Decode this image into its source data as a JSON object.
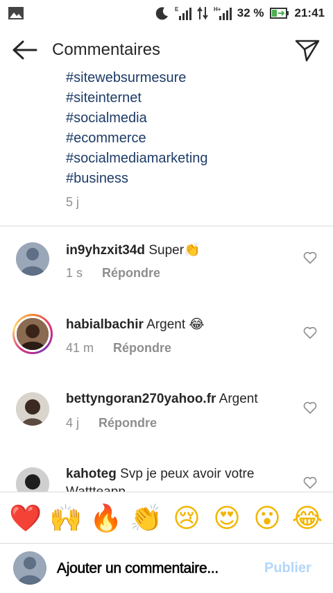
{
  "status_bar": {
    "battery": "32 %",
    "time": "21:41",
    "icons": [
      "image-icon",
      "moon-icon",
      "signal-e-icon",
      "data-arrows-icon",
      "signal-h-icon",
      "battery-icon"
    ]
  },
  "header": {
    "title": "Commentaires",
    "back_icon": "arrow-left-icon",
    "send_icon": "send-icon"
  },
  "caption": {
    "hashtags": [
      "#sitewebsurmesure",
      "#siteinternet",
      "#socialmedia",
      "#ecommerce",
      "#socialmediamarketing",
      "#business"
    ],
    "time": "5 j"
  },
  "comments": [
    {
      "username": "in9yhzxit34d",
      "text": "Super👏",
      "time": "1 s",
      "reply_label": "Répondre",
      "story_ring": false
    },
    {
      "username": "habialbachir",
      "text": "Argent 😂",
      "time": "41 m",
      "reply_label": "Répondre",
      "story_ring": true
    },
    {
      "username": "bettyngoran270yahoo.fr",
      "text": "Argent",
      "time": "4 j",
      "reply_label": "Répondre",
      "story_ring": false
    },
    {
      "username": "kahoteg",
      "text": "Svp je peux avoir votre",
      "text_cont": "Wattteapp",
      "story_ring": false
    }
  ],
  "reactions": [
    "❤️",
    "🙌",
    "🔥",
    "👏",
    "😢",
    "😍",
    "😮",
    "😂"
  ],
  "composer": {
    "placeholder": "Ajouter un commentaire...",
    "publish_label": "Publier"
  },
  "colors": {
    "hashtag": "#1d3b67",
    "meta_gray": "#8e8e8e",
    "publish_disabled": "#b3d6fa",
    "divider": "#dbdbdb"
  }
}
